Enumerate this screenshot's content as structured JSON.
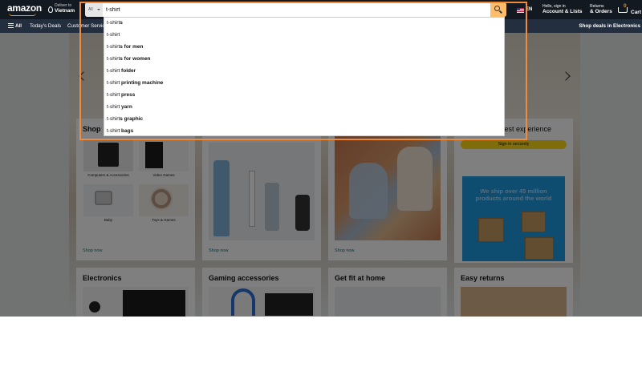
{
  "header": {
    "logo": "amazon",
    "deliver_to": "Deliver to",
    "location": "Vietnam",
    "search_category": "All",
    "search_value": "t-shirt",
    "language": "EN",
    "account_line1": "Hello, sign in",
    "account_line2": "Account & Lists",
    "returns_line1": "Returns",
    "returns_line2": "& Orders",
    "cart_count": "0",
    "cart_label": "Cart"
  },
  "subnav": {
    "all": "All",
    "todays_deals": "Today's Deals",
    "customer_service": "Customer Servic",
    "promo": "Shop deals in Electronics"
  },
  "suggestions": [
    {
      "typed": "t-shirt",
      "rest": "s"
    },
    {
      "typed": "t-shirt",
      "rest": ""
    },
    {
      "typed": "t-shirt",
      "rest": "s for men"
    },
    {
      "typed": "t-shirt",
      "rest": "s for women"
    },
    {
      "typed": "t-shirt",
      "rest": " folder"
    },
    {
      "typed": "t-shirt",
      "rest": " printing machine"
    },
    {
      "typed": "t-shirt",
      "rest": " press"
    },
    {
      "typed": "t-shirt",
      "rest": " yarn"
    },
    {
      "typed": "t-shirt",
      "rest": "s graphic"
    },
    {
      "typed": "t-shirt",
      "rest": " bags"
    }
  ],
  "cards": {
    "shop_title": "Shop",
    "shop_items": [
      "Computers & Accessories",
      "Video Games",
      "Baby",
      "Toys & Games"
    ],
    "shop_now": "Shop now",
    "signin_text": "e best experience",
    "signin_button": "Sign in securely",
    "ship_text": "We ship over 45 million products around the world",
    "electronics": "Electronics",
    "gaming": "Gaming accessories",
    "fit": "Get fit at home",
    "returns": "Easy returns"
  },
  "colors": {
    "nav_bg": "#131921",
    "subnav_bg": "#232f3e",
    "search_button": "#febd69",
    "focus_ring": "#f08b3c",
    "sign_in_button": "#ffd814"
  }
}
